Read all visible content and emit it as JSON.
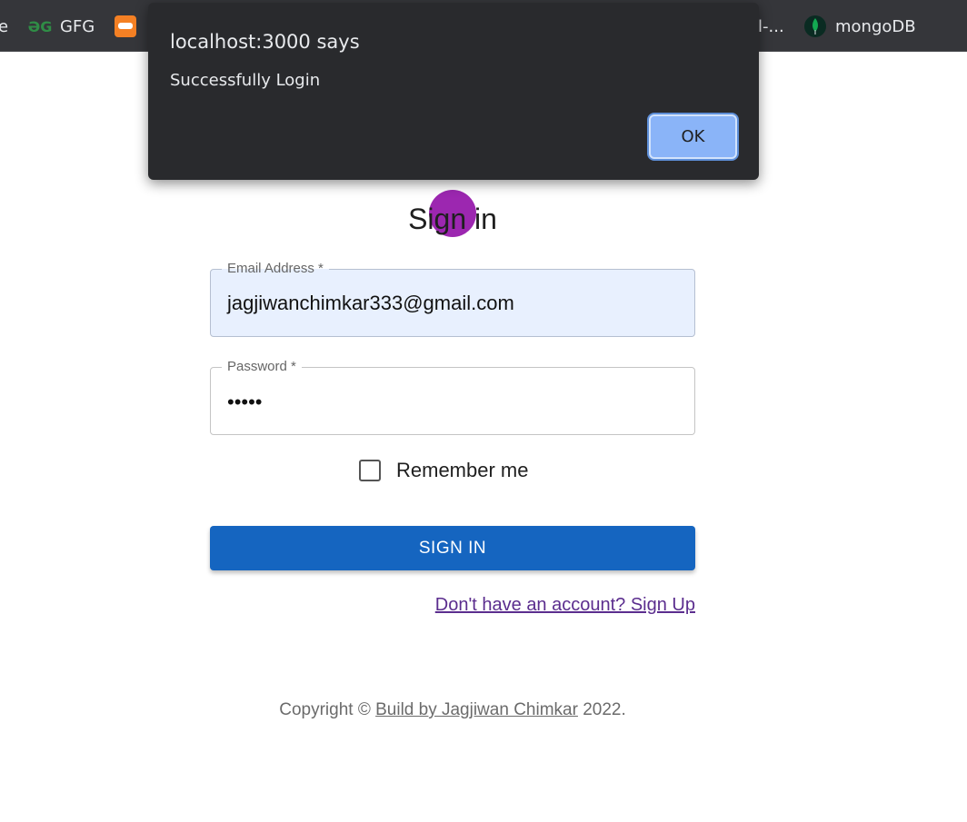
{
  "bookmarks": {
    "partial_left": "e",
    "gfg": "GFG",
    "partial_right": "l-...",
    "mongodb": "mongoDB"
  },
  "page": {
    "title": "Sign in",
    "email": {
      "label": "Email Address *",
      "value": "jagjiwanchimkar333@gmail.com"
    },
    "password": {
      "label": "Password *",
      "masked": "•••••"
    },
    "remember_label": "Remember me",
    "signin_button": "SIGN IN",
    "signup_link": "Don't have an account? Sign Up",
    "copyright": {
      "prefix": "Copyright © ",
      "link": "Build by Jagjiwan Chimkar",
      "suffix": " 2022."
    }
  },
  "dialog": {
    "title": "localhost:3000 says",
    "message": "Successfully Login",
    "ok_label": "OK"
  },
  "colors": {
    "bookmarks_bg": "#35363a",
    "dialog_bg": "#292a2d",
    "ok_button": "#8ab4f8",
    "signin_button": "#1565c0",
    "avatar": "#9c27b0",
    "email_autofill_bg": "#e8f0fe"
  }
}
